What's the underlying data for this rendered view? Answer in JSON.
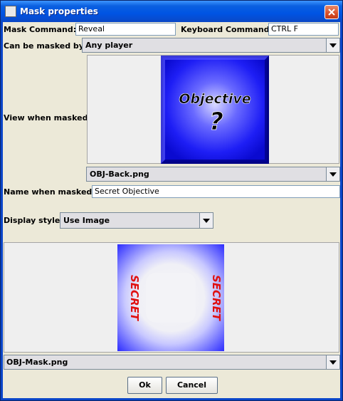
{
  "window": {
    "title": "Mask properties"
  },
  "form": {
    "mask_command_label": "Mask Command:",
    "mask_command_value": "Reveal",
    "keyboard_command_label": "Keyboard Command:",
    "keyboard_command_value": "CTRL F",
    "masked_by_label": "Can be masked by:",
    "masked_by_value": "Any player",
    "view_when_masked_label": "View when masked:",
    "masked_image_text": "Objective",
    "masked_image_symbol": "?",
    "masked_image_file": "OBJ-Back.png",
    "name_when_masked_label": "Name when masked:",
    "name_when_masked_value": "Secret Objective",
    "display_style_label": "Display style:",
    "display_style_value": "Use Image",
    "mask_image_word": "SECRET",
    "mask_image_file": "OBJ-Mask.png"
  },
  "buttons": {
    "ok": "Ok",
    "cancel": "Cancel"
  },
  "colors": {
    "title_blue": "#0054e3",
    "dialog_bg": "#ece9d8",
    "objective_blue": "#1a1aff",
    "secret_red": "#e01010"
  }
}
